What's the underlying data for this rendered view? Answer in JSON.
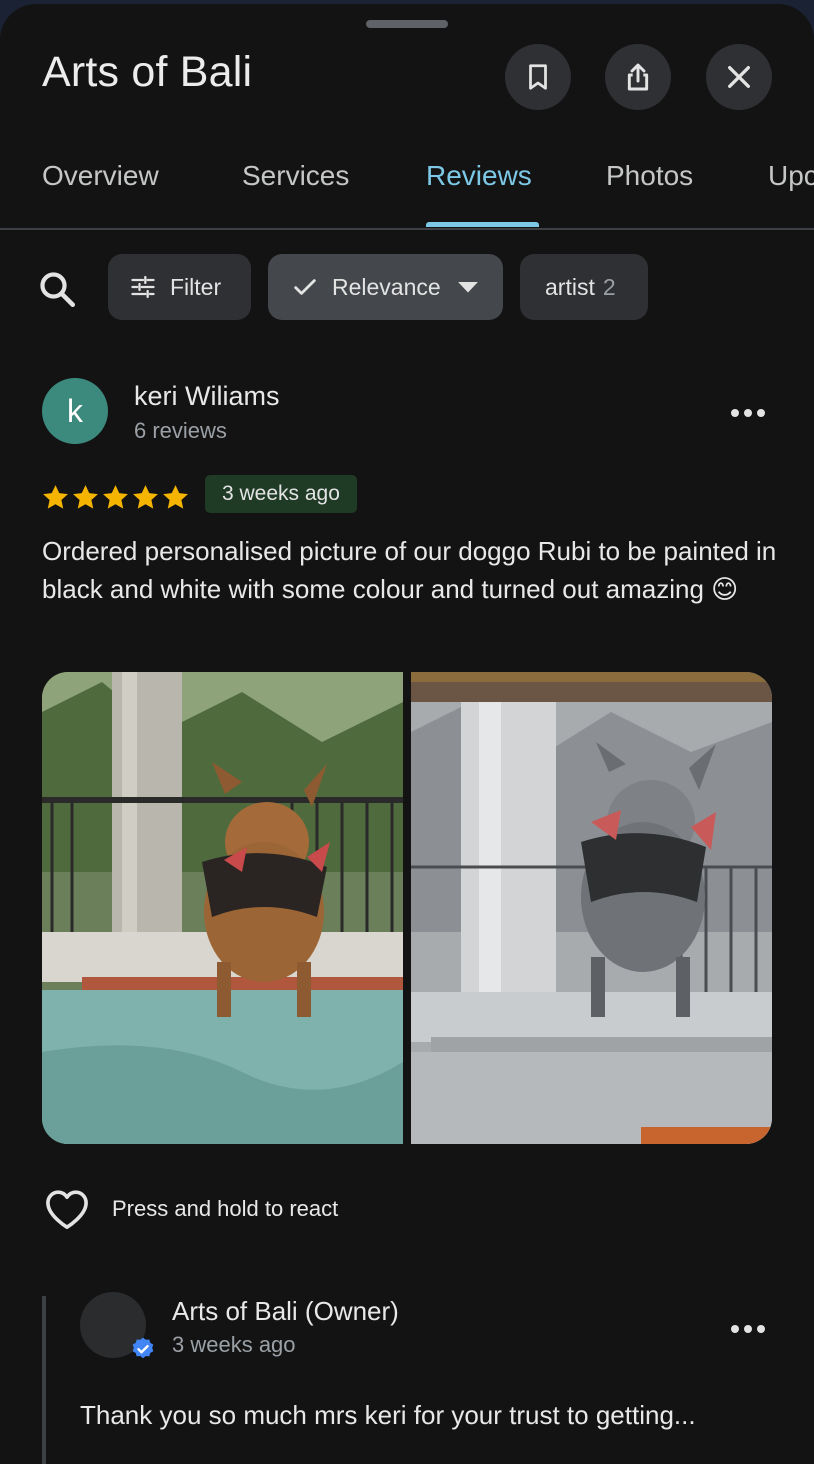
{
  "header": {
    "title": "Arts of Bali",
    "save_icon": "bookmark-icon",
    "share_icon": "share-icon",
    "close_icon": "close-icon"
  },
  "tabs": [
    {
      "label": "Overview"
    },
    {
      "label": "Services"
    },
    {
      "label": "Reviews",
      "active": true
    },
    {
      "label": "Photos"
    },
    {
      "label": "Upc"
    }
  ],
  "filters": {
    "search_icon": "search-icon",
    "filter_label": "Filter",
    "sort_label": "Relevance",
    "topic_label": "artist",
    "topic_count": "2"
  },
  "review": {
    "avatar_letter": "k",
    "author": "keri Wiliams",
    "author_reviews": "6 reviews",
    "rating": 5,
    "time": "3 weeks ago",
    "text": "Ordered personalised picture of our doggo Rubi to be painted in black and white with some colour and turned out amazing 😊",
    "react_hint": "Press and hold to react"
  },
  "owner_reply": {
    "author": "Arts of Bali (Owner)",
    "time": "3 weeks ago",
    "text": "Thank you so much mrs keri for your trust to getting..."
  },
  "colors": {
    "accent": "#7cc8e6",
    "star": "#f4b400",
    "avatar": "#3c8a7e",
    "time_badge": "#1f3a25"
  }
}
